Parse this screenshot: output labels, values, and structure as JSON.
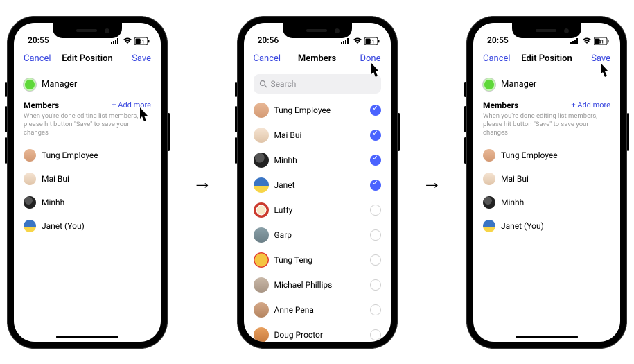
{
  "status_time_1": "20:55",
  "status_time_2": "20:56",
  "status_time_3": "20:55",
  "battery_level": "41",
  "nav": {
    "cancel": "Cancel",
    "edit_title": "Edit Position",
    "members_title": "Members",
    "save": "Save",
    "done": "Done"
  },
  "position_name": "Manager",
  "members_label": "Members",
  "add_more": "+ Add more",
  "hint": "When you're done editing list members, please hit button \"Save\" to save your changes",
  "search_placeholder": "Search",
  "edit_members": [
    {
      "name": "Tung Employee",
      "avatar": "av1"
    },
    {
      "name": "Mai Bui",
      "avatar": "av2"
    },
    {
      "name": "Minhh",
      "avatar": "av3"
    },
    {
      "name": "Janet (You)",
      "avatar": "av4"
    }
  ],
  "picker_members": [
    {
      "name": "Tung Employee",
      "avatar": "av1",
      "checked": true
    },
    {
      "name": "Mai Bui",
      "avatar": "av2",
      "checked": true
    },
    {
      "name": "Minhh",
      "avatar": "av3",
      "checked": true
    },
    {
      "name": "Janet",
      "avatar": "av4",
      "checked": true
    },
    {
      "name": "Luffy",
      "avatar": "av5",
      "checked": false
    },
    {
      "name": "Garp",
      "avatar": "av6",
      "checked": false
    },
    {
      "name": "Tùng Teng",
      "avatar": "av7",
      "checked": false
    },
    {
      "name": "Michael Phillips",
      "avatar": "av8",
      "checked": false
    },
    {
      "name": "Anne Pena",
      "avatar": "av9",
      "checked": false
    },
    {
      "name": "Doug Proctor",
      "avatar": "av10",
      "checked": false
    }
  ]
}
